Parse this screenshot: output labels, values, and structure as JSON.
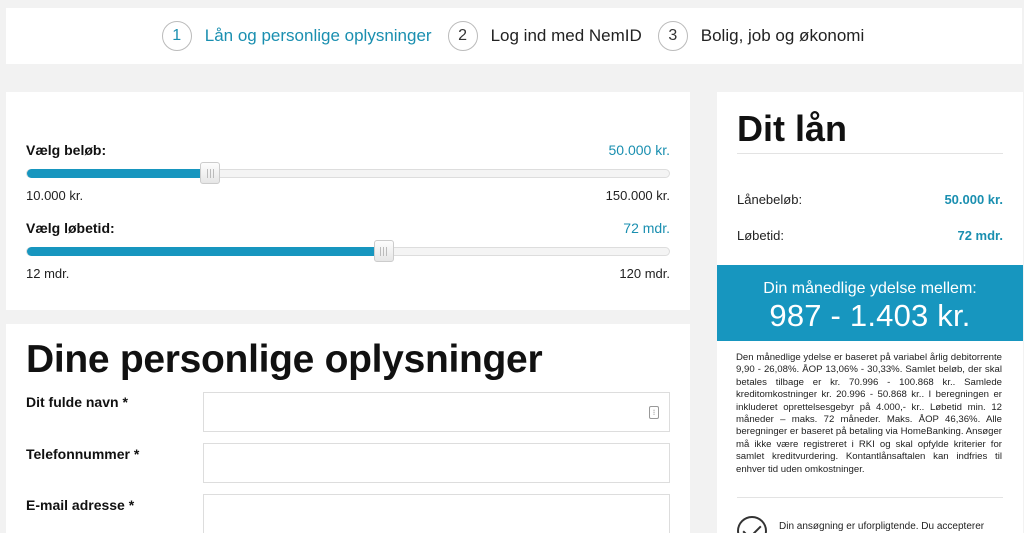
{
  "steps": [
    {
      "num": "1",
      "label": "Lån og personlige oplysninger"
    },
    {
      "num": "2",
      "label": "Log ind med NemID"
    },
    {
      "num": "3",
      "label": "Bolig, job og økonomi"
    }
  ],
  "amount_slider": {
    "title": "Vælg beløb:",
    "value": "50.000 kr.",
    "min_label": "10.000 kr.",
    "max_label": "150.000 kr.",
    "min": 10000,
    "max": 150000,
    "current": 50000
  },
  "term_slider": {
    "title": "Vælg løbetid:",
    "value": "72 mdr.",
    "min_label": "12 mdr.",
    "max_label": "120 mdr.",
    "min": 12,
    "max": 120,
    "current": 72
  },
  "personal": {
    "heading": "Dine personlige oplysninger",
    "fields": [
      {
        "label": "Dit fulde navn *",
        "value": ""
      },
      {
        "label": "Telefonnummer *",
        "value": ""
      },
      {
        "label": "E-mail adresse *",
        "value": ""
      }
    ]
  },
  "loan": {
    "heading": "Dit lån",
    "amount_label": "Lånebeløb:",
    "amount_value": "50.000 kr.",
    "term_label": "Løbetid:",
    "term_value": "72 mdr.",
    "payment_title": "Din månedlige ydelse mellem:",
    "payment_range": "987 - 1.403 kr.",
    "disclaimer": "Den månedlige ydelse er baseret på variabel årlig debitorrente 9,90 - 26,08%. ÅOP 13,06% - 30,33%. Samlet beløb, der skal betales tilbage er kr. 70.996 - 100.868 kr.. Samlede kreditomkostninger kr. 20.996 - 50.868 kr.. I beregningen er inkluderet oprettelsesgebyr på 4.000,- kr.. Løbetid min. 12 måneder – maks. 72 måneder. Maks. ÅOP 46,36%. Alle beregninger er baseret på betaling via HomeBanking. Ansøger må ikke være registreret i RKI og skal opfylde kriterier for samlet kreditvurdering. Kontantlånsaftalen kan indfries til enhver tid uden omkostninger.",
    "consent_text": "Din ansøgning er uforpligtende. Du accepterer"
  },
  "colors": {
    "accent": "#1796bf",
    "accent_text": "#1a8fb0",
    "background": "#f2f2f2"
  }
}
